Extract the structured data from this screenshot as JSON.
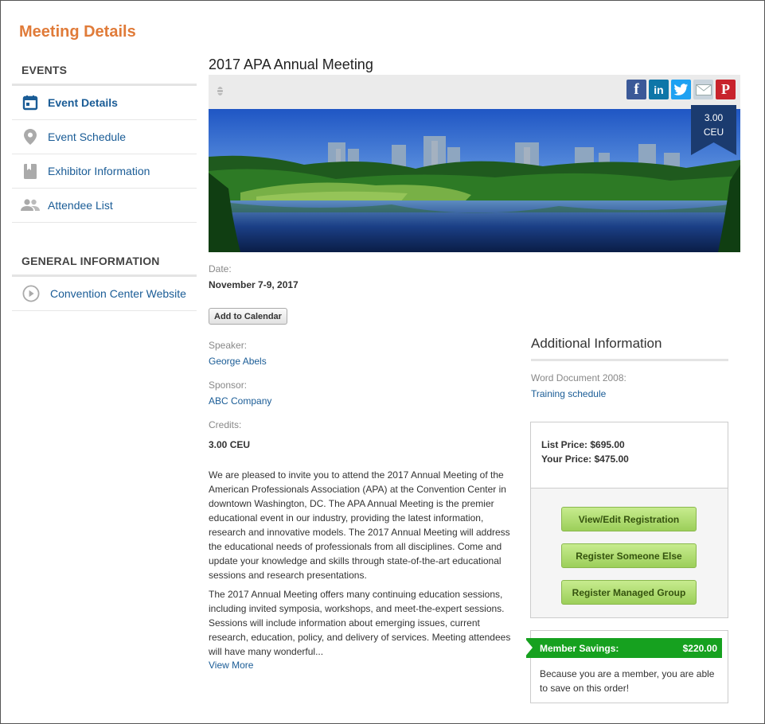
{
  "page": {
    "title": "Meeting Details"
  },
  "sidebar": {
    "events_heading": "EVENTS",
    "items": [
      {
        "label": "Event Details",
        "icon": "calendar-icon",
        "active": true
      },
      {
        "label": "Event Schedule",
        "icon": "location-pin-icon"
      },
      {
        "label": "Exhibitor Information",
        "icon": "bookmark-icon"
      },
      {
        "label": "Attendee List",
        "icon": "people-icon"
      }
    ],
    "general_heading": "GENERAL INFORMATION",
    "general_items": [
      {
        "label": "Convention Center Website",
        "icon": "play-circle-icon"
      }
    ]
  },
  "event": {
    "title": "2017 APA Annual Meeting",
    "ribbon_value": "3.00",
    "ribbon_unit": "CEU",
    "date_label": "Date:",
    "date_value": "November 7-9, 2017",
    "add_to_calendar": "Add to Calendar",
    "speaker_label": "Speaker:",
    "speaker_value": "George Abels",
    "sponsor_label": "Sponsor:",
    "sponsor_value": "ABC Company",
    "credits_label": "Credits:",
    "credits_value": "3.00 CEU",
    "description_p1": "We are pleased to invite you to attend the 2017 Annual Meeting of the American Professionals Association (APA) at the Convention Center in downtown Washington, DC. The APA Annual Meeting is the premier educational event in our industry, providing the latest information, research and innovative models. The 2017 Annual Meeting will address the educational needs of professionals from all disciplines. Come and update your knowledge and skills through state-of-the-art educational sessions and research presentations.",
    "description_p2": "The 2017 Annual Meeting offers many continuing education sessions, including invited symposia, workshops, and meet-the-expert sessions. Sessions will include information about emerging issues, current research, education, policy, and delivery of services. Meeting attendees will have many wonderful...",
    "view_more": "View More"
  },
  "share": {
    "icons": [
      "facebook-icon",
      "linkedin-icon",
      "twitter-icon",
      "email-icon",
      "pinterest-icon"
    ],
    "colors": {
      "facebook": "#3b5998",
      "linkedin": "#0e76a8",
      "twitter": "#1da1f2",
      "email": "#c8d3dc",
      "pinterest": "#c8232c"
    }
  },
  "additional": {
    "title": "Additional Information",
    "doc_label": "Word Document 2008:",
    "doc_link": "Training schedule",
    "list_price": "List Price: $695.00",
    "your_price": "Your Price: $475.00",
    "buttons": [
      "View/Edit Registration",
      "Register Someone Else",
      "Register Managed Group"
    ]
  },
  "savings": {
    "label": "Member Savings:",
    "amount": "$220.00",
    "text": "Because you are a member, you are able to save on this order!"
  },
  "colors": {
    "accent": "#e07b39",
    "link": "#1a5c96",
    "ribbon": "#1b3b6f",
    "savings": "#16a11f"
  }
}
